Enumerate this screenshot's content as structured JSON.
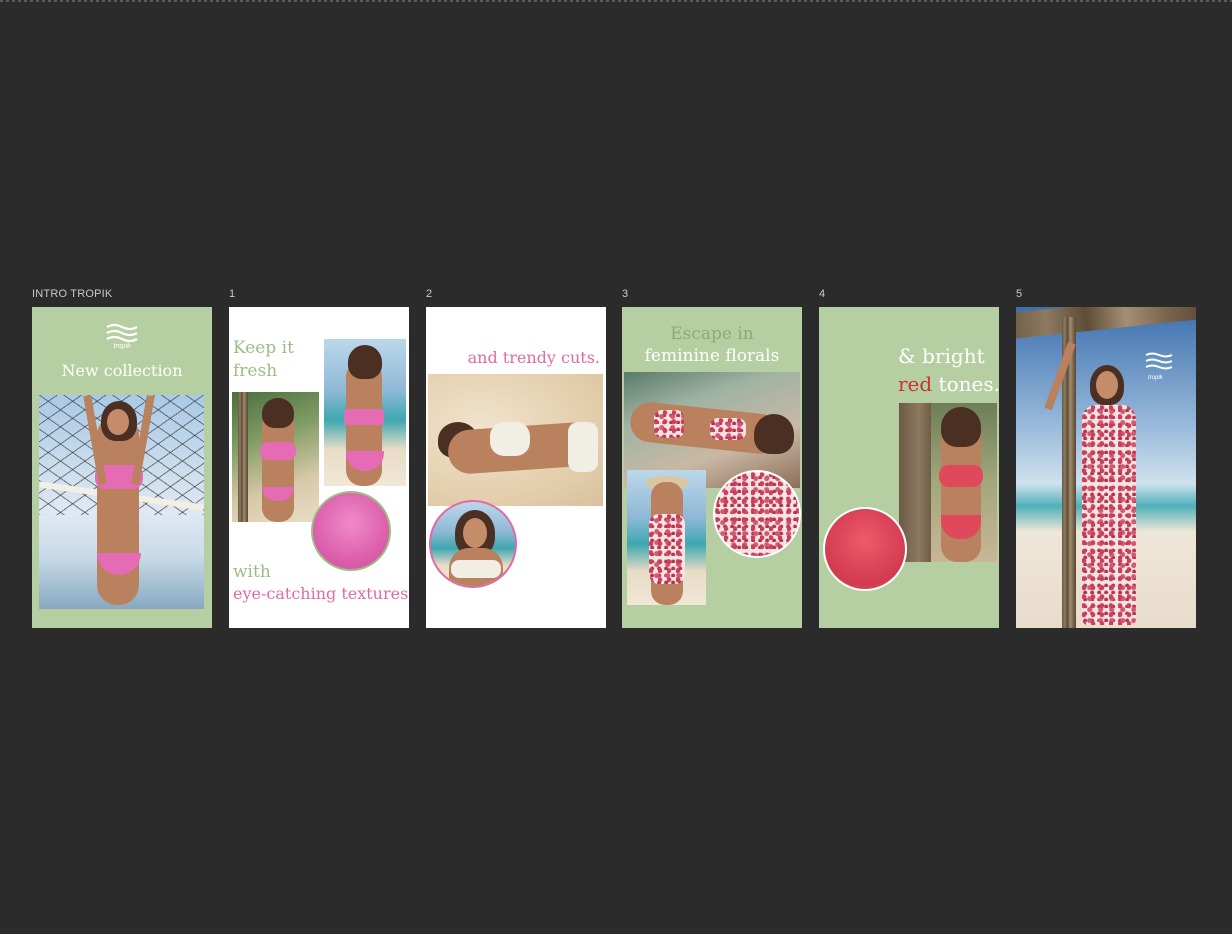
{
  "canvas": {
    "background": "#2b2b2b"
  },
  "colors": {
    "sage": "#b6cfa2",
    "pink_text": "#e06aa7",
    "red_text": "#c8323e",
    "white": "#ffffff"
  },
  "frames": [
    {
      "label": "INTRO TROPIK",
      "heading": "New collection",
      "logo_signature": "tropik"
    },
    {
      "label": "1",
      "line1": "Keep it",
      "line2": "fresh",
      "line3": "with",
      "line4": "eye-catching textures"
    },
    {
      "label": "2",
      "heading": "and trendy cuts."
    },
    {
      "label": "3",
      "line1": "Escape in",
      "line2": "feminine florals"
    },
    {
      "label": "4",
      "line1": "& bright",
      "line2_accent": "red",
      "line2_rest": " tones."
    },
    {
      "label": "5",
      "logo_signature": "tropik"
    }
  ],
  "icons": [
    "wave-logo-icon"
  ]
}
